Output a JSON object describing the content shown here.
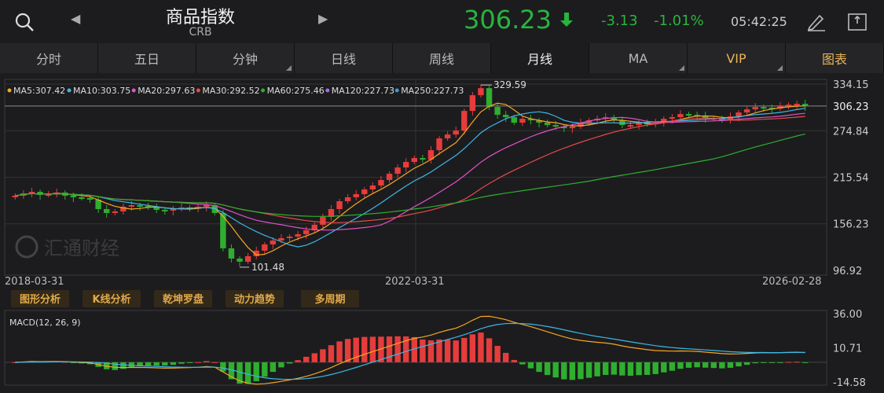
{
  "header": {
    "title": "商品指数",
    "subtitle": "CRB",
    "price": "306.23",
    "change": "-3.13",
    "change_pct": "-1.01%",
    "time": "05:42:25",
    "icons": [
      "search-icon",
      "prev-arrow-icon",
      "next-arrow-icon",
      "down-arrow-icon",
      "pen-icon",
      "share-icon"
    ]
  },
  "tabs": [
    {
      "label": "分时",
      "corner": false
    },
    {
      "label": "五日",
      "corner": false
    },
    {
      "label": "分钟",
      "corner": true
    },
    {
      "label": "日线",
      "corner": false
    },
    {
      "label": "周线",
      "corner": false
    },
    {
      "label": "月线",
      "corner": false,
      "active": true
    },
    {
      "label": "MA",
      "corner": true
    },
    {
      "label": "VIP",
      "corner": true
    },
    {
      "label": "图表",
      "corner": false
    }
  ],
  "ma_legend": [
    {
      "label": "MA5:307.42",
      "color": "#f5a623"
    },
    {
      "label": "MA10:303.75",
      "color": "#3db8e8"
    },
    {
      "label": "MA20:297.63",
      "color": "#e052c9"
    },
    {
      "label": "MA30:292.52",
      "color": "#e84a4a"
    },
    {
      "label": "MA60:275.46",
      "color": "#2fae2f"
    },
    {
      "label": "MA120:227.73",
      "color": "#a070e0"
    },
    {
      "label": "MA250:227.73",
      "color": "#3a9ed0"
    }
  ],
  "watermark": "汇通财经",
  "price_axis": [
    "334.15",
    "306.23",
    "274.84",
    "215.54",
    "156.23",
    "96.92"
  ],
  "date_axis": [
    "2018-03-31",
    "2022-03-31",
    "2026-02-28"
  ],
  "annotations": {
    "high": "329.59",
    "low": "101.48"
  },
  "analysis_buttons": [
    "图形分析",
    "K线分析",
    "乾坤罗盘",
    "动力趋势",
    "多周期"
  ],
  "macd": {
    "label": "MACD(12, 26, 9)",
    "axis": [
      "36.00",
      "10.71",
      "-14.58"
    ]
  },
  "colors": {
    "up": "#e63c3c",
    "down": "#2fae2f",
    "bg": "#1c1c1e"
  },
  "chart_data": {
    "type": "candlestick",
    "ylim": [
      96.92,
      334.15
    ],
    "closes": [
      192,
      195,
      197,
      193,
      194,
      196,
      192,
      190,
      189,
      187,
      175,
      170,
      172,
      178,
      180,
      179,
      177,
      174,
      173,
      175,
      177,
      176,
      178,
      180,
      170,
      125,
      112,
      108,
      115,
      122,
      130,
      135,
      138,
      140,
      143,
      148,
      155,
      165,
      175,
      185,
      190,
      194,
      200,
      205,
      212,
      220,
      228,
      235,
      240,
      238,
      250,
      265,
      270,
      275,
      300,
      320,
      329,
      305,
      295,
      292,
      285,
      290,
      288,
      285,
      282,
      280,
      278,
      280,
      285,
      288,
      290,
      292,
      288,
      282,
      282,
      285,
      283,
      285,
      290,
      292,
      296,
      295,
      294,
      291,
      290,
      289,
      293,
      298,
      302,
      305,
      304,
      303,
      306,
      308,
      309,
      306
    ]
  }
}
